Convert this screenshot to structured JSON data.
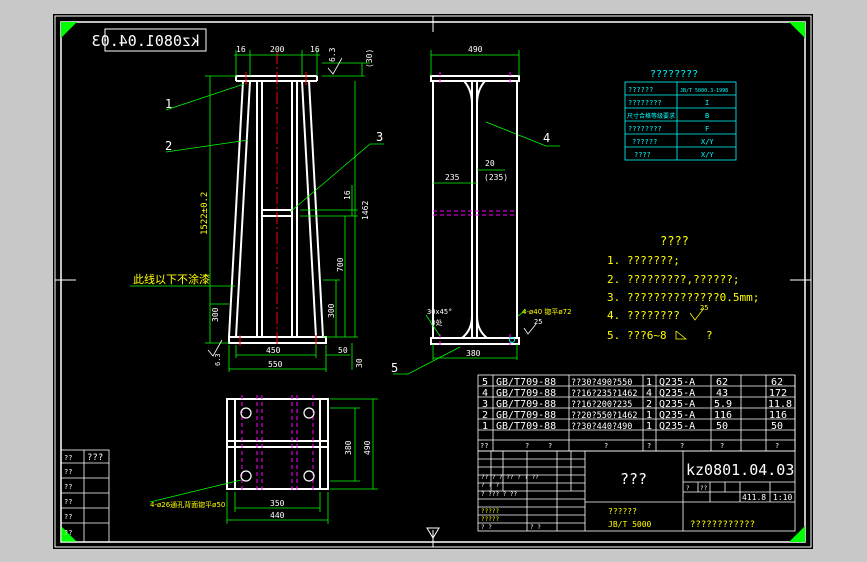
{
  "colors": {
    "sheet": "#000000",
    "outer": "#c8c8c8",
    "frame": "#ffffff",
    "corner": "#00ff00",
    "part": "#ffffff",
    "dim": "#00ff00",
    "hidden": "#ff00ff",
    "text": "#ffffff",
    "note": "#ffff00",
    "leader": "#00ff00",
    "table": "#00ffff",
    "red": "#ff0000"
  },
  "drawing_number": "kz0801.04.03",
  "drawing_number_mirrored": "kz0801.04.03",
  "part_labels": [
    "1",
    "2",
    "3",
    "4",
    "5"
  ],
  "front_view": {
    "dims_top": [
      "16",
      "200",
      "16"
    ],
    "roughness_top": "6.3",
    "dim_30": "(30)",
    "dim_height": "1522±0.2",
    "dim_16": "16",
    "dim_1462": "1462",
    "dim_700": "700",
    "dim_300_left": "300",
    "dim_300_right": "300",
    "dim_450": "450",
    "dim_550": "550",
    "dim_50": "50",
    "dim_30_bottom": "30",
    "roughness_bottom": "6.3",
    "paint_note": "此线以下不涂漆"
  },
  "side_view": {
    "dim_490": "490",
    "dim_20": "20",
    "dim_235": "235",
    "dim_235_paren": "(235)",
    "dim_380": "380",
    "chamfer": "30x45°",
    "chamfer_note": "3处",
    "hole_note": "4-ø40 锪平ø72",
    "roughness": "25"
  },
  "bottom_view": {
    "dim_380": "380",
    "dim_490": "490",
    "dim_350": "350",
    "dim_440": "440",
    "hole_note": "4-ø26通孔背面锪平ø50"
  },
  "surface_table": {
    "title": "????????",
    "rows": [
      [
        "??????",
        "JB/T 5000.3-1998"
      ],
      [
        "????????",
        "I"
      ],
      [
        "尺寸合格等级要求",
        "B"
      ],
      [
        "????????",
        "F"
      ],
      [
        "??????",
        "X/Y"
      ],
      [
        "????",
        "X/Y"
      ]
    ]
  },
  "tech_req": {
    "title": "????",
    "items": [
      "1. ???????;",
      "2. ?????????,??????;",
      "3. ??????????????0.5mm;",
      "4. ????????",
      "5. ???6~8"
    ],
    "item4_mark": "25",
    "item5_tail": "?"
  },
  "bom": {
    "rows": [
      [
        "5",
        "GB/T709-88",
        "??30?490?550",
        "1",
        "Q235-A",
        "62",
        "62"
      ],
      [
        "4",
        "GB/T709-88",
        "??16?235?1462",
        "4",
        "Q235-A",
        "43",
        "172"
      ],
      [
        "3",
        "GB/T709-88",
        "??16?200?235",
        "2",
        "Q235-A",
        "5.9",
        "11.8"
      ],
      [
        "2",
        "GB/T709-88",
        "??20?550?1462",
        "1",
        "Q235-A",
        "116",
        "116"
      ],
      [
        "1",
        "GB/T709-88",
        "??30?440?490",
        "1",
        "Q235-A",
        "50",
        "50"
      ]
    ],
    "header": [
      "??",
      "?",
      "?",
      "?",
      "?",
      "?",
      "?",
      "?"
    ]
  },
  "title_block": {
    "name": "???",
    "drawing_no": "kz0801.04.03",
    "weight": "411.8",
    "scale": "1:10",
    "standard": "JB/T 5000",
    "std_label": "??????",
    "company": "????????????",
    "small_q": "?",
    "small_qq": "??",
    "row_a": "??  ?  ?  ??  ?  ?  ??",
    "row_b": "?  ?  ?",
    "row_c": "? ??? ? ??",
    "row_d": "?????",
    "row_e": "?????",
    "row_f": "?  ?",
    "row_g": "?   ?"
  },
  "revision_table": {
    "header": "???",
    "rows": [
      "??",
      "??",
      "??",
      "??",
      "??",
      "??"
    ]
  }
}
